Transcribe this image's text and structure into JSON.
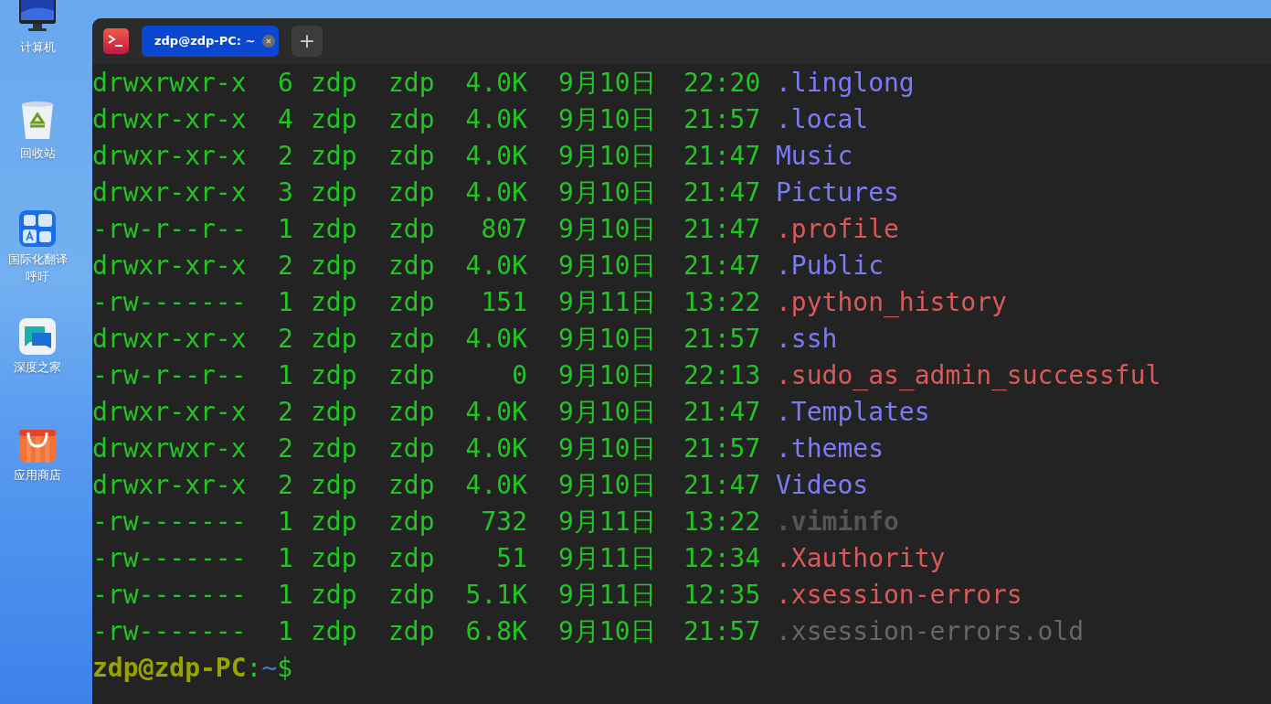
{
  "desktop_icons": [
    {
      "label": "计算机",
      "kind": "computer"
    },
    {
      "label": "回收站",
      "kind": "trash"
    },
    {
      "label": "国际化翻译呼吁",
      "kind": "translate"
    },
    {
      "label": "深度之家",
      "kind": "chat"
    },
    {
      "label": "应用商店",
      "kind": "store"
    }
  ],
  "terminal": {
    "tabs": [
      {
        "label": "zdp@zdp-PC: ~",
        "selected": true
      }
    ],
    "new_tab": "+",
    "rows": [
      {
        "perms": "drwxrwxr-x",
        "links": "6",
        "owner": "zdp",
        "group": "zdp",
        "size": "4.0K",
        "date": "9月10日",
        "time": "22:20",
        "name": ".linglong",
        "color": "#7b7bf5",
        "bold": false
      },
      {
        "perms": "drwxr-xr-x",
        "links": "4",
        "owner": "zdp",
        "group": "zdp",
        "size": "4.0K",
        "date": "9月10日",
        "time": "21:57",
        "name": ".local",
        "color": "#7b7bf5",
        "bold": false
      },
      {
        "perms": "drwxr-xr-x",
        "links": "2",
        "owner": "zdp",
        "group": "zdp",
        "size": "4.0K",
        "date": "9月10日",
        "time": "21:47",
        "name": "Music",
        "color": "#7b7bf5",
        "bold": false
      },
      {
        "perms": "drwxr-xr-x",
        "links": "3",
        "owner": "zdp",
        "group": "zdp",
        "size": "4.0K",
        "date": "9月10日",
        "time": "21:47",
        "name": "Pictures",
        "color": "#7b7bf5",
        "bold": false
      },
      {
        "perms": "-rw-r--r--",
        "links": "1",
        "owner": "zdp",
        "group": "zdp",
        "size": "807",
        "date": "9月10日",
        "time": "21:47",
        "name": ".profile",
        "color": "#d95858",
        "bold": false
      },
      {
        "perms": "drwxr-xr-x",
        "links": "2",
        "owner": "zdp",
        "group": "zdp",
        "size": "4.0K",
        "date": "9月10日",
        "time": "21:47",
        "name": ".Public",
        "color": "#7b7bf5",
        "bold": false
      },
      {
        "perms": "-rw-------",
        "links": "1",
        "owner": "zdp",
        "group": "zdp",
        "size": "151",
        "date": "9月11日",
        "time": "13:22",
        "name": ".python_history",
        "color": "#d95858",
        "bold": false
      },
      {
        "perms": "drwxr-xr-x",
        "links": "2",
        "owner": "zdp",
        "group": "zdp",
        "size": "4.0K",
        "date": "9月10日",
        "time": "21:57",
        "name": ".ssh",
        "color": "#7b7bf5",
        "bold": false
      },
      {
        "perms": "-rw-r--r--",
        "links": "1",
        "owner": "zdp",
        "group": "zdp",
        "size": "0",
        "date": "9月10日",
        "time": "22:13",
        "name": ".sudo_as_admin_successful",
        "color": "#d95858",
        "bold": false
      },
      {
        "perms": "drwxr-xr-x",
        "links": "2",
        "owner": "zdp",
        "group": "zdp",
        "size": "4.0K",
        "date": "9月10日",
        "time": "21:47",
        "name": ".Templates",
        "color": "#7b7bf5",
        "bold": false
      },
      {
        "perms": "drwxrwxr-x",
        "links": "2",
        "owner": "zdp",
        "group": "zdp",
        "size": "4.0K",
        "date": "9月10日",
        "time": "21:57",
        "name": ".themes",
        "color": "#7b7bf5",
        "bold": false
      },
      {
        "perms": "drwxr-xr-x",
        "links": "2",
        "owner": "zdp",
        "group": "zdp",
        "size": "4.0K",
        "date": "9月10日",
        "time": "21:47",
        "name": "Videos",
        "color": "#7b7bf5",
        "bold": false
      },
      {
        "perms": "-rw-------",
        "links": "1",
        "owner": "zdp",
        "group": "zdp",
        "size": "732",
        "date": "9月11日",
        "time": "13:22",
        "name": ".viminfo",
        "color": "#555555",
        "bold": true
      },
      {
        "perms": "-rw-------",
        "links": "1",
        "owner": "zdp",
        "group": "zdp",
        "size": "51",
        "date": "9月11日",
        "time": "12:34",
        "name": ".Xauthority",
        "color": "#d95858",
        "bold": false
      },
      {
        "perms": "-rw-------",
        "links": "1",
        "owner": "zdp",
        "group": "zdp",
        "size": "5.1K",
        "date": "9月11日",
        "time": "12:35",
        "name": ".xsession-errors",
        "color": "#d95858",
        "bold": false
      },
      {
        "perms": "-rw-------",
        "links": "1",
        "owner": "zdp",
        "group": "zdp",
        "size": "6.8K",
        "date": "9月10日",
        "time": "21:57",
        "name": ".xsession-errors.old",
        "color": "#666666",
        "bold": false
      }
    ],
    "prompt": {
      "user_host": "zdp@zdp-PC",
      "separator": ":",
      "path": "~",
      "symbol": "$"
    }
  }
}
